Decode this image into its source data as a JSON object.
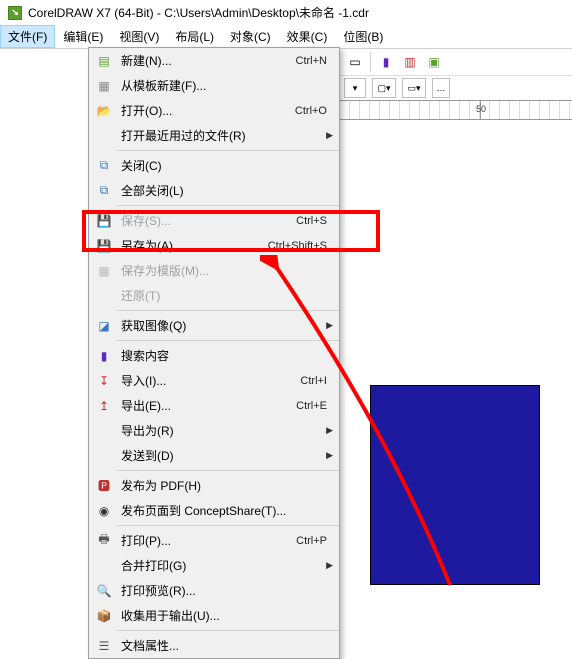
{
  "title": "CorelDRAW X7 (64-Bit) - C:\\Users\\Admin\\Desktop\\未命名 -1.cdr",
  "menubar": {
    "file": "文件(F)",
    "edit": "编辑(E)",
    "view": "视图(V)",
    "layout": "布局(L)",
    "object": "对象(C)",
    "effect": "效果(C)",
    "bitmap": "位图(B)"
  },
  "ruler": {
    "tick50": "50"
  },
  "menu": {
    "new": {
      "label": "新建(N)...",
      "shortcut": "Ctrl+N"
    },
    "new_from_template": {
      "label": "从模板新建(F)..."
    },
    "open": {
      "label": "打开(O)...",
      "shortcut": "Ctrl+O"
    },
    "open_recent": {
      "label": "打开最近用过的文件(R)"
    },
    "close": {
      "label": "关闭(C)"
    },
    "close_all": {
      "label": "全部关闭(L)"
    },
    "save": {
      "label": "保存(S)...",
      "shortcut": "Ctrl+S"
    },
    "save_as": {
      "label": "另存为(A)...",
      "shortcut": "Ctrl+Shift+S"
    },
    "save_as_template": {
      "label": "保存为模版(M)..."
    },
    "revert": {
      "label": "还原(T)"
    },
    "acquire_image": {
      "label": "获取图像(Q)"
    },
    "search_content": {
      "label": "搜索内容"
    },
    "import": {
      "label": "导入(I)...",
      "shortcut": "Ctrl+I"
    },
    "export": {
      "label": "导出(E)...",
      "shortcut": "Ctrl+E"
    },
    "export_for": {
      "label": "导出为(R)"
    },
    "send_to": {
      "label": "发送到(D)"
    },
    "publish_pdf": {
      "label": "发布为 PDF(H)"
    },
    "publish_concept": {
      "label": "发布页面到 ConceptShare(T)..."
    },
    "print": {
      "label": "打印(P)...",
      "shortcut": "Ctrl+P"
    },
    "merge_print": {
      "label": "合并打印(G)"
    },
    "print_preview": {
      "label": "打印预览(R)..."
    },
    "collect_for_output": {
      "label": "收集用于输出(U)..."
    },
    "doc_props": {
      "label": "文档属性..."
    }
  }
}
